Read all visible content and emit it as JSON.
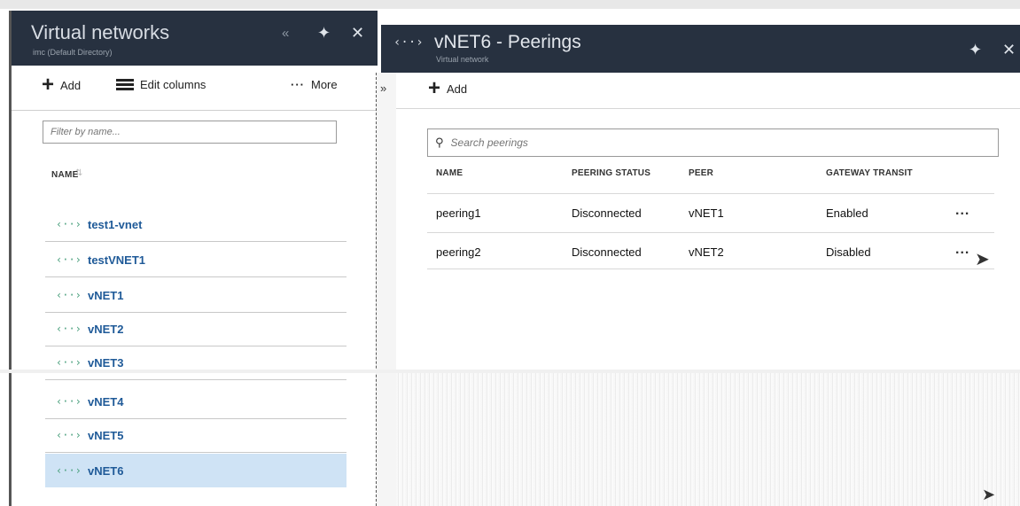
{
  "left_blade": {
    "title": "Virtual networks",
    "subtitle": "imc (Default Directory)",
    "header_icons": {
      "collapse": "«",
      "pin": "✦",
      "close": "✕"
    },
    "toolbar": {
      "add_label": "Add",
      "edit_columns_label": "Edit columns",
      "more_label": "More"
    },
    "filter": {
      "placeholder": "Filter by name...",
      "value": ""
    },
    "column_name": "NAME",
    "networks": [
      {
        "name": "test1-vnet",
        "selected": false
      },
      {
        "name": "testVNET1",
        "selected": false
      },
      {
        "name": "vNET1",
        "selected": false
      },
      {
        "name": "vNET2",
        "selected": false
      },
      {
        "name": "vNET3",
        "selected": false
      },
      {
        "name": "vNET4",
        "selected": false
      },
      {
        "name": "vNET5",
        "selected": false
      },
      {
        "name": "vNET6",
        "selected": true
      }
    ]
  },
  "collapse_strip": {
    "label": "»"
  },
  "right_blade": {
    "title": "vNET6 - Peerings",
    "subtitle": "Virtual network",
    "header_icons": {
      "pin": "✦",
      "close": "✕"
    },
    "toolbar": {
      "add_label": "Add"
    },
    "search": {
      "placeholder": "Search peerings",
      "value": ""
    },
    "columns": [
      "NAME",
      "PEERING STATUS",
      "PEER",
      "GATEWAY TRANSIT"
    ],
    "rows": [
      {
        "name": "peering1",
        "status": "Disconnected",
        "peer": "vNET1",
        "gateway_transit": "Enabled",
        "menu": "..."
      },
      {
        "name": "peering2",
        "status": "Disconnected",
        "peer": "vNET2",
        "gateway_transit": "Disabled",
        "menu": "..."
      }
    ]
  },
  "colors": {
    "header_bg": "#273140",
    "selected_bg": "#cfe3f5",
    "link": "#1f5a98",
    "vnet_icon": "#4aa07d"
  }
}
